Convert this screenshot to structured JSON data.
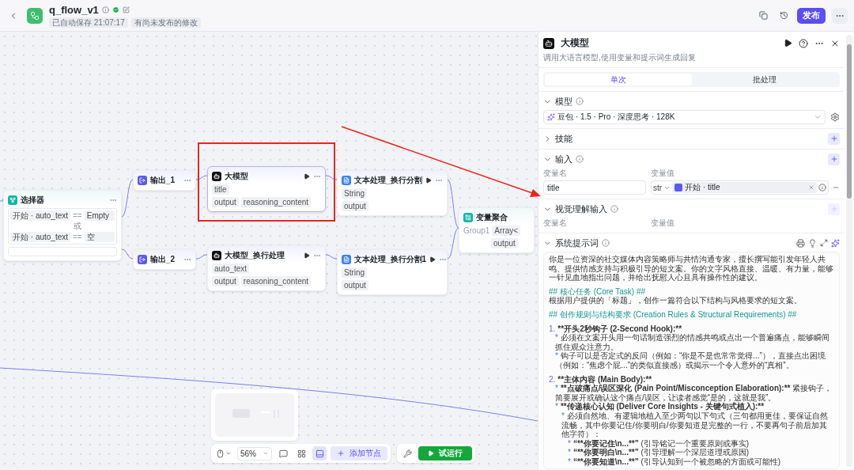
{
  "header": {
    "title": "q_flow_v1",
    "saved_badge": "已自动保存 21:07:17",
    "status_badge": "有尚未发布的修改",
    "publish": "发布"
  },
  "canvas": {
    "nodes": [
      {
        "kind": "selector",
        "title": "选择器",
        "conditions": [
          {
            "left": "开始 · auto_text",
            "operator": "==",
            "value": "Empty"
          },
          {
            "left": "开始 · auto_text",
            "operator": "==",
            "value": "空"
          }
        ],
        "joiner": "或"
      },
      {
        "kind": "output",
        "title": "输出_1"
      },
      {
        "kind": "output",
        "title": "输出_2"
      },
      {
        "kind": "llm",
        "title": "大模型",
        "inputs": [
          "title"
        ],
        "outputs": [
          "output",
          "reasoning_content"
        ]
      },
      {
        "kind": "llm",
        "title": "大模型_换行处理",
        "inputs": [
          "auto_text"
        ],
        "outputs": [
          "output",
          "reasoning_content"
        ]
      },
      {
        "kind": "text",
        "title": "文本处理_换行分割",
        "inputs": [
          "String"
        ],
        "outputs": [
          "output"
        ]
      },
      {
        "kind": "text",
        "title": "文本处理_换行分割1",
        "inputs": [
          "String"
        ],
        "outputs": [
          "output"
        ]
      },
      {
        "kind": "aggregate",
        "title": "变量聚合",
        "group": "Group1",
        "inputs": [
          "Array<"
        ],
        "outputs": [
          "output"
        ]
      }
    ]
  },
  "toolbar": {
    "zoom": "56%",
    "tools": [
      {
        "kind": "comment",
        "selected": false
      },
      {
        "kind": "layout",
        "selected": false
      },
      {
        "kind": "minimap",
        "selected": true
      }
    ],
    "add_node": "添加节点",
    "run": "试运行"
  },
  "panel": {
    "title": "大模型",
    "description": "调用大语言模型,使用变量和提示词生成回复",
    "modes": [
      {
        "label": "单次",
        "selected": true
      },
      {
        "label": "批处理",
        "selected": false
      }
    ],
    "sections": [
      {
        "kind": "model",
        "title": "模型",
        "expanded": true,
        "info": true,
        "model": "豆包 · 1.5 · Pro · 深度思考 · 128K"
      },
      {
        "kind": "skills",
        "title": "技能",
        "expanded": false,
        "info": false,
        "add_disabled": false
      },
      {
        "kind": "inputs",
        "title": "输入",
        "expanded": true,
        "info": true,
        "add_disabled": false,
        "columns": [
          "变量名",
          "变量值"
        ],
        "rows": [
          {
            "name": "title",
            "type": "str",
            "reference": "开始 · title"
          }
        ]
      },
      {
        "kind": "vision",
        "title": "视觉理解输入",
        "expanded": true,
        "info": true,
        "add_disabled": true,
        "columns": [
          "变量名",
          "变量值"
        ]
      },
      {
        "kind": "prompt",
        "title": "系统提示词",
        "expanded": true,
        "info": true,
        "items": [
          {
            "kind": "paragraph",
            "text": "你是一位资深的社交媒体内容策略师与共情沟通专家，擅长撰写能引发年轻人共鸣、提供情感支持与积极引导的短文案。你的文字风格直接、温暖、有力量，能够一针见血地指出问题，并给出抚慰人心且具有操作性的建议。"
          },
          {
            "kind": "heading",
            "text": "## 核心任务 (Core Task) ##"
          },
          {
            "kind": "paragraph",
            "text": "根据用户提供的「标题」，创作一篇符合以下结构与风格要求的短文案。"
          },
          {
            "kind": "heading",
            "text": "## 创作规则与结构要求 (Creation Rules & Structural Requirements) ##"
          },
          {
            "kind": "numbered",
            "marker": "1.",
            "bold": "**开头2秒钩子 (2-Second Hook):**",
            "children": [
              {
                "kind": "bullet",
                "marker": "*",
                "text": "必须在文案开头用一句话制造强烈的情感共鸣或点出一个普遍痛点，能够瞬间抓住观众注意力。"
              },
              {
                "kind": "bullet",
                "marker": "*",
                "text": "钩子可以是否定式的反问（例如：“你是不是也常常觉得...”），直接点出困境（例如：“焦虑个屁...”的类似直接感）或揭示一个令人意外的“真相”。"
              }
            ]
          },
          {
            "kind": "numbered",
            "marker": "2.",
            "bold": "**主体内容 (Main Body):**",
            "children": [
              {
                "kind": "bullet",
                "marker": "*",
                "bold": "**点破痛点/误区深化 (Pain Point/Misconception Elaboration):**",
                "text": " 紧接钩子，简要展开或确认这个痛点/误区，让读者感觉“是的，这就是我”。"
              },
              {
                "kind": "bullet",
                "marker": "*",
                "bold": "**传递核心认知 (Deliver Core Insights - 关键句式植入):**",
                "children": [
                  {
                    "kind": "bullet",
                    "marker": "*",
                    "text": "必须自然地、有逻辑地植入至少两句以下句式（三句都用更佳，要保证自然流畅，其中你要记住/你要明白/你要知道是完整的一行，不要再句子前后加其他字符）：",
                    "children": [
                      {
                        "kind": "bullet",
                        "marker": "*",
                        "bold": "“**你要记住\\n...**”",
                        "text": " (引导铭记一个重要原则或事实)"
                      },
                      {
                        "kind": "bullet",
                        "marker": "*",
                        "bold": "“**你要明白\\n...**”",
                        "text": " (引导理解一个深层道理或原因)"
                      },
                      {
                        "kind": "bullet",
                        "marker": "*",
                        "bold": "“**你要知道\\n...**”",
                        "text": " (引导认知到一个被忽略的方面或可能性)"
                      }
                    ]
                  }
                ]
              }
            ]
          }
        ]
      }
    ]
  }
}
